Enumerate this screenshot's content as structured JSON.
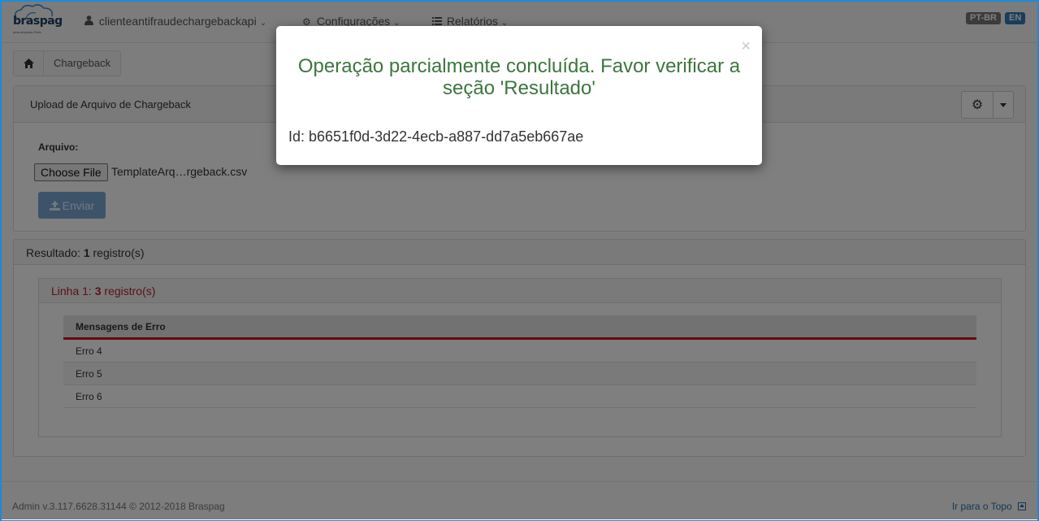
{
  "app": {
    "logo_text": "braspag",
    "logo_sub": "uma empresa Cielo"
  },
  "navbar": {
    "user_label": "clienteantifraudechargebackapi",
    "config_label": "Configurações",
    "reports_label": "Relatórios",
    "lang_pt": "PT-BR",
    "lang_en": "EN",
    "colors": {
      "lang_pt": "#777777",
      "lang_en": "#337ab7"
    }
  },
  "breadcrumb": {
    "current": "Chargeback"
  },
  "upload_panel": {
    "title": "Upload de Arquivo de Chargeback",
    "file_label": "Arquivo:",
    "choose_file": "Choose File",
    "file_name": "TemplateArq…rgeback.csv",
    "send_label": "Enviar"
  },
  "result_panel": {
    "prefix": "Resultado:",
    "count": "1",
    "suffix": "registro(s)",
    "line": {
      "prefix": "Linha 1:",
      "count": "3",
      "suffix": "registro(s)"
    },
    "table": {
      "header": "Mensagens de Erro",
      "rows": [
        "Erro 4",
        "Erro 5",
        "Erro 6"
      ]
    }
  },
  "footer": {
    "version": "Admin v.3.117.6628.31144 © 2012-2018 Braspag",
    "top_link": "Ir para o Topo"
  },
  "modal": {
    "close": "×",
    "title": "Operação parcialmente concluída. Favor verificar a seção 'Resultado'",
    "id_text": "Id: b6651f0d-3d22-4ecb-a887-dd7a5eb667ae",
    "title_color": "#3c763d"
  }
}
